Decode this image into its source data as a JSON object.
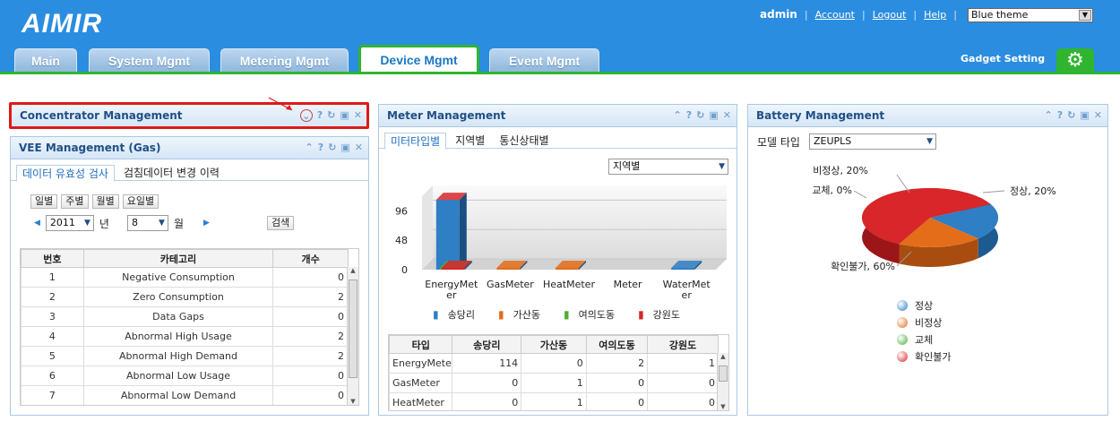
{
  "app": {
    "logo": "AIMIR",
    "user": "admin",
    "links": [
      "Account",
      "Logout",
      "Help"
    ],
    "theme": "Blue theme",
    "gadget_setting": "Gadget Setting"
  },
  "nav": {
    "tabs": [
      "Main",
      "System Mgmt",
      "Metering Mgmt",
      "Device Mgmt",
      "Event Mgmt"
    ],
    "active": "Device Mgmt"
  },
  "concentrator": {
    "title": "Concentrator Management"
  },
  "vee": {
    "title": "VEE Management (Gas)",
    "tabs": [
      "데이터 유효성 검사",
      "검침데이터 변경 이력"
    ],
    "period_buttons": [
      "일별",
      "주별",
      "월별",
      "요일별"
    ],
    "year": "2011",
    "year_unit": "년",
    "month": "8",
    "month_unit": "월",
    "search": "검색",
    "columns": [
      "번호",
      "카테고리",
      "개수"
    ],
    "rows": [
      [
        "1",
        "Negative Consumption",
        "0"
      ],
      [
        "2",
        "Zero Consumption",
        "2"
      ],
      [
        "3",
        "Data Gaps",
        "0"
      ],
      [
        "4",
        "Abnormal High Usage",
        "2"
      ],
      [
        "5",
        "Abnormal High Demand",
        "2"
      ],
      [
        "6",
        "Abnormal Low Usage",
        "0"
      ],
      [
        "7",
        "Abnormal Low Demand",
        "0"
      ]
    ]
  },
  "meter": {
    "title": "Meter Management",
    "tabs": [
      "미터타입별",
      "지역별",
      "통신상태별"
    ],
    "filter": "지역별",
    "table_columns": [
      "타입",
      "송당리",
      "가산동",
      "여의도동",
      "강원도"
    ],
    "table_rows": [
      [
        "EnergyMete",
        "114",
        "0",
        "2",
        "1"
      ],
      [
        "GasMeter",
        "0",
        "1",
        "0",
        "0"
      ],
      [
        "HeatMeter",
        "0",
        "1",
        "0",
        "0"
      ]
    ]
  },
  "battery": {
    "title": "Battery Management",
    "model_label": "모델 타입",
    "model": "ZEUPLS",
    "legend": [
      "정상",
      "비정상",
      "교체",
      "확인불가"
    ]
  },
  "chart_data": [
    {
      "type": "bar",
      "categories": [
        "EnergyMeter",
        "GasMeter",
        "HeatMeter",
        "Meter",
        "WaterMeter"
      ],
      "category_labels": [
        [
          "EnergyMet",
          "er"
        ],
        [
          "GasMeter"
        ],
        [
          "HeatMeter"
        ],
        [
          "Meter"
        ],
        [
          "WaterMet",
          "er"
        ]
      ],
      "series": [
        {
          "name": "송당리",
          "color": "#2f7fc4",
          "values": [
            114,
            0,
            0,
            0,
            1
          ]
        },
        {
          "name": "가산동",
          "color": "#e46d1a",
          "values": [
            0,
            1,
            1,
            0,
            0
          ]
        },
        {
          "name": "여의도동",
          "color": "#4caf3a",
          "values": [
            2,
            0,
            0,
            0,
            0
          ]
        },
        {
          "name": "강원도",
          "color": "#d8262a",
          "values": [
            1,
            0,
            0,
            0,
            0
          ]
        }
      ],
      "y_ticks": [
        0,
        48,
        96
      ],
      "ylim": [
        0,
        120
      ]
    },
    {
      "type": "pie",
      "labels": [
        "정상",
        "비정상",
        "교체",
        "확인불가"
      ],
      "values": [
        20,
        20,
        0,
        60
      ],
      "data_labels": [
        "정상, 20%",
        "비정상, 20%",
        "교체, 0%",
        "확인불가, 60%"
      ],
      "colors": [
        "#2f7fc4",
        "#e46d1a",
        "#4caf3a",
        "#d8262a"
      ]
    }
  ]
}
